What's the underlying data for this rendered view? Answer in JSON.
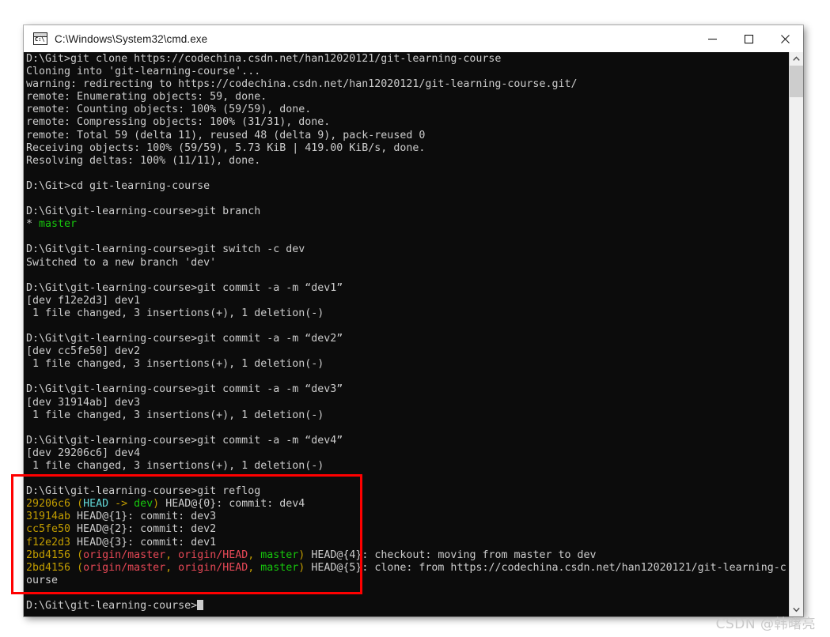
{
  "window": {
    "title": "C:\\Windows\\System32\\cmd.exe",
    "icon": "cmd-console-icon",
    "icon_text": "C:\\",
    "minimize_label": "Minimize",
    "maximize_label": "Maximize",
    "close_label": "Close"
  },
  "scrollbar": {
    "up_arrow": "▲",
    "down_arrow": "▼"
  },
  "colors": {
    "terminal_bg": "#0c0c0c",
    "terminal_fg": "#cccccc",
    "green": "#16c60c",
    "yellow": "#c19c00",
    "cyan": "#61d6d6",
    "red": "#e74856",
    "annotation_red": "#ff0000"
  },
  "annotation": {
    "name": "red-highlight-box",
    "target": "git reflog output"
  },
  "watermark": {
    "text": "CSDN @韩曙亮"
  },
  "terminal": {
    "prompt_root": "D:\\Git>",
    "prompt_repo": "D:\\Git\\git-learning-course>",
    "cursor": "block",
    "lines": [
      {
        "segments": [
          {
            "t": "D:\\Git>git clone https://codechina.csdn.net/han12020121/git-learning-course",
            "c": "white"
          }
        ]
      },
      {
        "segments": [
          {
            "t": "Cloning into 'git-learning-course'...",
            "c": "white"
          }
        ]
      },
      {
        "segments": [
          {
            "t": "warning: redirecting to https://codechina.csdn.net/han12020121/git-learning-course.git/",
            "c": "white"
          }
        ]
      },
      {
        "segments": [
          {
            "t": "remote: Enumerating objects: 59, done.",
            "c": "white"
          }
        ]
      },
      {
        "segments": [
          {
            "t": "remote: Counting objects: 100% (59/59), done.",
            "c": "white"
          }
        ]
      },
      {
        "segments": [
          {
            "t": "remote: Compressing objects: 100% (31/31), done.",
            "c": "white"
          }
        ]
      },
      {
        "segments": [
          {
            "t": "remote: Total 59 (delta 11), reused 48 (delta 9), pack-reused 0",
            "c": "white"
          }
        ]
      },
      {
        "segments": [
          {
            "t": "Receiving objects: 100% (59/59), 5.73 KiB | 419.00 KiB/s, done.",
            "c": "white"
          }
        ]
      },
      {
        "segments": [
          {
            "t": "Resolving deltas: 100% (11/11), done.",
            "c": "white"
          }
        ]
      },
      {
        "segments": [
          {
            "t": "",
            "c": "white"
          }
        ]
      },
      {
        "segments": [
          {
            "t": "D:\\Git>cd git-learning-course",
            "c": "white"
          }
        ]
      },
      {
        "segments": [
          {
            "t": "",
            "c": "white"
          }
        ]
      },
      {
        "segments": [
          {
            "t": "D:\\Git\\git-learning-course>git branch",
            "c": "white"
          }
        ]
      },
      {
        "segments": [
          {
            "t": "* ",
            "c": "white"
          },
          {
            "t": "master",
            "c": "green"
          }
        ]
      },
      {
        "segments": [
          {
            "t": "",
            "c": "white"
          }
        ]
      },
      {
        "segments": [
          {
            "t": "D:\\Git\\git-learning-course>git switch -c dev",
            "c": "white"
          }
        ]
      },
      {
        "segments": [
          {
            "t": "Switched to a new branch 'dev'",
            "c": "white"
          }
        ]
      },
      {
        "segments": [
          {
            "t": "",
            "c": "white"
          }
        ]
      },
      {
        "segments": [
          {
            "t": "D:\\Git\\git-learning-course>git commit -a -m “dev1”",
            "c": "white"
          }
        ]
      },
      {
        "segments": [
          {
            "t": "[dev f12e2d3] dev1",
            "c": "white"
          }
        ]
      },
      {
        "segments": [
          {
            "t": " 1 file changed, 3 insertions(+), 1 deletion(-)",
            "c": "white"
          }
        ]
      },
      {
        "segments": [
          {
            "t": "",
            "c": "white"
          }
        ]
      },
      {
        "segments": [
          {
            "t": "D:\\Git\\git-learning-course>git commit -a -m “dev2”",
            "c": "white"
          }
        ]
      },
      {
        "segments": [
          {
            "t": "[dev cc5fe50] dev2",
            "c": "white"
          }
        ]
      },
      {
        "segments": [
          {
            "t": " 1 file changed, 3 insertions(+), 1 deletion(-)",
            "c": "white"
          }
        ]
      },
      {
        "segments": [
          {
            "t": "",
            "c": "white"
          }
        ]
      },
      {
        "segments": [
          {
            "t": "D:\\Git\\git-learning-course>git commit -a -m “dev3”",
            "c": "white"
          }
        ]
      },
      {
        "segments": [
          {
            "t": "[dev 31914ab] dev3",
            "c": "white"
          }
        ]
      },
      {
        "segments": [
          {
            "t": " 1 file changed, 3 insertions(+), 1 deletion(-)",
            "c": "white"
          }
        ]
      },
      {
        "segments": [
          {
            "t": "",
            "c": "white"
          }
        ]
      },
      {
        "segments": [
          {
            "t": "D:\\Git\\git-learning-course>git commit -a -m “dev4”",
            "c": "white"
          }
        ]
      },
      {
        "segments": [
          {
            "t": "[dev 29206c6] dev4",
            "c": "white"
          }
        ]
      },
      {
        "segments": [
          {
            "t": " 1 file changed, 3 insertions(+), 1 deletion(-)",
            "c": "white"
          }
        ]
      },
      {
        "segments": [
          {
            "t": "",
            "c": "white"
          }
        ]
      },
      {
        "segments": [
          {
            "t": "D:\\Git\\git-learning-course>git reflog",
            "c": "white"
          }
        ]
      },
      {
        "segments": [
          {
            "t": "29206c6",
            "c": "yellow"
          },
          {
            "t": " ",
            "c": "white"
          },
          {
            "t": "(",
            "c": "yellow"
          },
          {
            "t": "HEAD",
            "c": "cyan"
          },
          {
            "t": " -> ",
            "c": "yellow"
          },
          {
            "t": "dev",
            "c": "green"
          },
          {
            "t": ")",
            "c": "yellow"
          },
          {
            "t": " HEAD@{0}: commit: dev4",
            "c": "white"
          }
        ]
      },
      {
        "segments": [
          {
            "t": "31914ab",
            "c": "yellow"
          },
          {
            "t": " HEAD@{1}: commit: dev3",
            "c": "white"
          }
        ]
      },
      {
        "segments": [
          {
            "t": "cc5fe50",
            "c": "yellow"
          },
          {
            "t": " HEAD@{2}: commit: dev2",
            "c": "white"
          }
        ]
      },
      {
        "segments": [
          {
            "t": "f12e2d3",
            "c": "yellow"
          },
          {
            "t": " HEAD@{3}: commit: dev1",
            "c": "white"
          }
        ]
      },
      {
        "segments": [
          {
            "t": "2bd4156",
            "c": "yellow"
          },
          {
            "t": " ",
            "c": "white"
          },
          {
            "t": "(",
            "c": "yellow"
          },
          {
            "t": "origin/master",
            "c": "red"
          },
          {
            "t": ", ",
            "c": "yellow"
          },
          {
            "t": "origin/HEAD",
            "c": "red"
          },
          {
            "t": ", ",
            "c": "yellow"
          },
          {
            "t": "master",
            "c": "green"
          },
          {
            "t": ")",
            "c": "yellow"
          },
          {
            "t": " HEAD@{4}: checkout: moving from master to dev",
            "c": "white"
          }
        ]
      },
      {
        "segments": [
          {
            "t": "2bd4156",
            "c": "yellow"
          },
          {
            "t": " ",
            "c": "white"
          },
          {
            "t": "(",
            "c": "yellow"
          },
          {
            "t": "origin/master",
            "c": "red"
          },
          {
            "t": ", ",
            "c": "yellow"
          },
          {
            "t": "origin/HEAD",
            "c": "red"
          },
          {
            "t": ", ",
            "c": "yellow"
          },
          {
            "t": "master",
            "c": "green"
          },
          {
            "t": ")",
            "c": "yellow"
          },
          {
            "t": " HEAD@{5}: clone: from https://codechina.csdn.net/han12020121/git-learning-c",
            "c": "white"
          }
        ]
      },
      {
        "segments": [
          {
            "t": "ourse",
            "c": "white"
          }
        ]
      },
      {
        "segments": [
          {
            "t": "",
            "c": "white"
          }
        ]
      },
      {
        "segments": [
          {
            "t": "D:\\Git\\git-learning-course>",
            "c": "white"
          },
          {
            "cursor": true
          }
        ]
      }
    ]
  }
}
